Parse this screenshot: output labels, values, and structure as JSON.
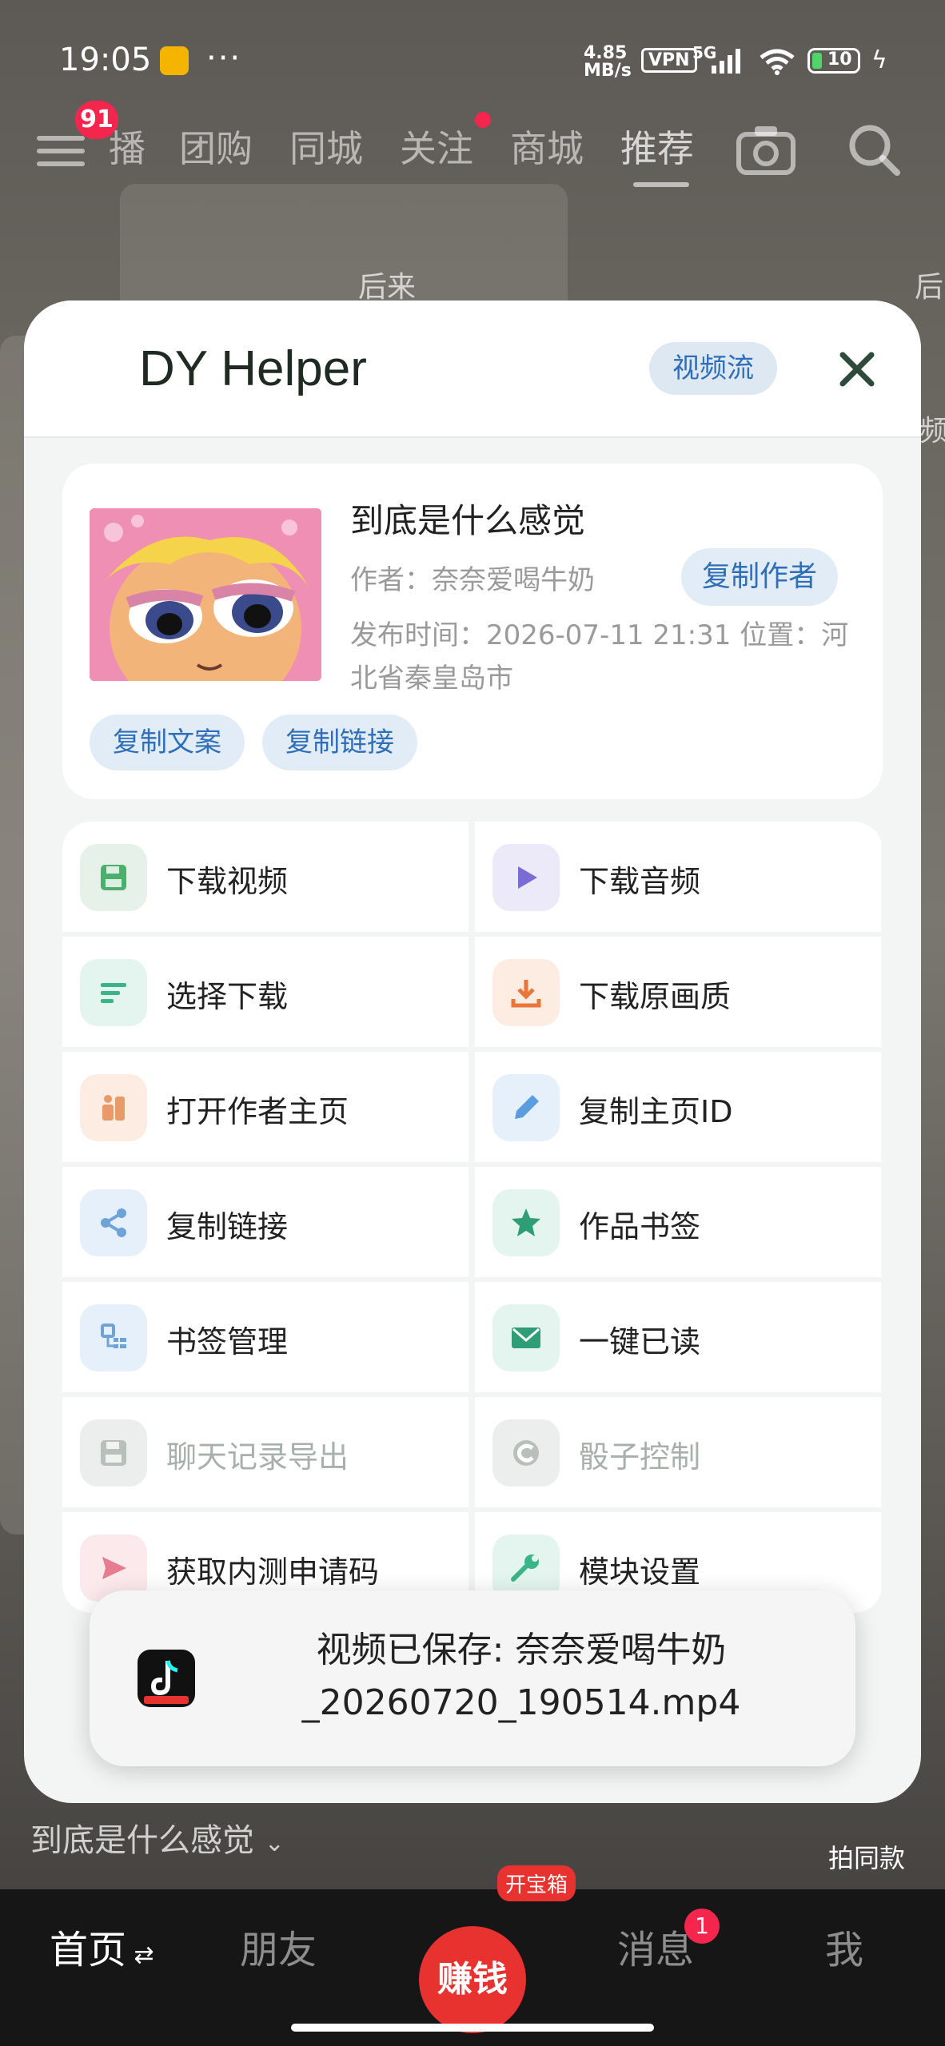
{
  "status_bar": {
    "time": "19:05",
    "dots": "···",
    "speed": "4.85\nMB/s",
    "vpn": "VPN",
    "network": "5G",
    "battery": "10"
  },
  "top_nav": {
    "badge": "91",
    "tabs": [
      "播",
      "团购",
      "同城",
      "关注",
      "商城",
      "推荐"
    ]
  },
  "overlay": {
    "left_text": "后来",
    "right_text": "后",
    "right_text2": "频"
  },
  "sheet": {
    "title": "DY Helper",
    "mode_chip": "视频流",
    "video": {
      "title": "到底是什么感觉",
      "author": "作者：奈奈爱喝牛奶",
      "copy_author": "复制作者",
      "meta": "发布时间：2026-07-11 21:31  位置：河北省秦皇岛市",
      "copy_text": "复制文案",
      "copy_link": "复制链接"
    },
    "actions": [
      {
        "label": "下载视频",
        "icon": "save-icon",
        "tint": "#e6f2e9",
        "color": "#4caf6e",
        "dim": false
      },
      {
        "label": "下载音频",
        "icon": "play-icon",
        "tint": "#ece9f8",
        "color": "#7b6bd6",
        "dim": false
      },
      {
        "label": "选择下载",
        "icon": "list-icon",
        "tint": "#e4f5ef",
        "color": "#3cb48a",
        "dim": false
      },
      {
        "label": "下载原画质",
        "icon": "download-icon",
        "tint": "#fdece2",
        "color": "#e8763a",
        "dim": false
      },
      {
        "label": "打开作者主页",
        "icon": "person-icon",
        "tint": "#fdece2",
        "color": "#e89a6a",
        "dim": false
      },
      {
        "label": "复制主页ID",
        "icon": "pencil-icon",
        "tint": "#e6f0fa",
        "color": "#5b9be0",
        "dim": false
      },
      {
        "label": "复制链接",
        "icon": "share-icon",
        "tint": "#e6f0fa",
        "color": "#6ea3d8",
        "dim": false
      },
      {
        "label": "作品书签",
        "icon": "star-icon",
        "tint": "#e4f5ef",
        "color": "#2f9e77",
        "dim": false
      },
      {
        "label": "书签管理",
        "icon": "bookmark-manage-icon",
        "tint": "#e6f0fa",
        "color": "#6ea3d8",
        "dim": false
      },
      {
        "label": "一键已读",
        "icon": "mail-icon",
        "tint": "#e4f5ef",
        "color": "#2f9e77",
        "dim": false
      },
      {
        "label": "聊天记录导出",
        "icon": "save-icon",
        "tint": "#eceeed",
        "color": "#b9c0bb",
        "dim": true
      },
      {
        "label": "骰子控制",
        "icon": "dice-icon",
        "tint": "#eceeed",
        "color": "#b9c0bb",
        "dim": true
      },
      {
        "label": "获取内测申请码",
        "icon": "send-icon",
        "tint": "#fbe9ec",
        "color": "#e77b8f",
        "dim": false
      },
      {
        "label": "模块设置",
        "icon": "wrench-icon",
        "tint": "#e4f5ef",
        "color": "#3cb48a",
        "dim": false
      }
    ]
  },
  "toast": {
    "text": "视频已保存: 奈奈爱喝牛奶_20260720_190514.mp4"
  },
  "below": {
    "desc": "到底是什么感觉",
    "same": "拍同款"
  },
  "bottom_nav": {
    "home": "首页",
    "friends": "朋友",
    "earn": "赚钱",
    "treasure": "开宝箱",
    "messages": "消息",
    "msg_badge": "1",
    "me": "我"
  }
}
